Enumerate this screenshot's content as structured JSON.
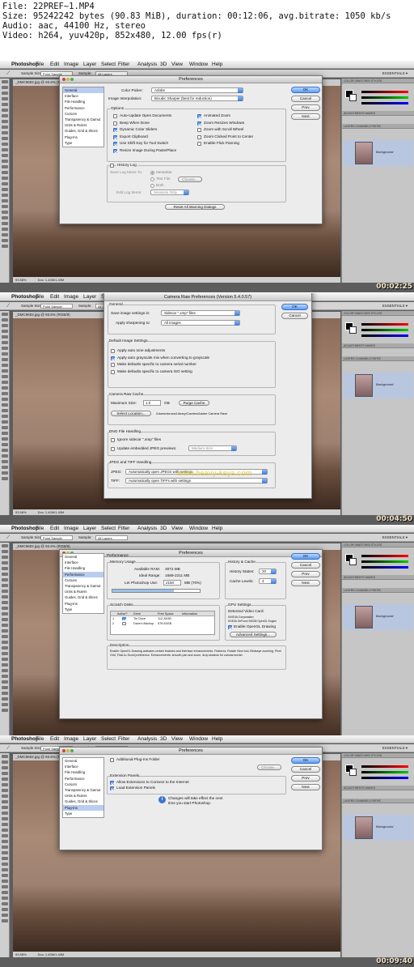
{
  "header": {
    "line1": "File: 22PREF~1.MP4",
    "line2": "Size: 95242242 bytes (90.83 MiB), duration: 00:12:06, avg.bitrate: 1050 kb/s",
    "line3": "Audio: aac, 44100 Hz, stereo",
    "line4": "Video: h264, yuv420p, 852x480, 12.00 fps(r)"
  },
  "app": {
    "menu": [
      "Photoshop",
      "File",
      "Edit",
      "Image",
      "Layer",
      "Select",
      "Filter",
      "Analysis",
      "3D",
      "View",
      "Window",
      "Help"
    ],
    "options": {
      "sample_size_label": "Sample Size:",
      "sample_size_value": "Point Sample",
      "sample_label": "Sample:",
      "sample_value": "All Layers",
      "workspace": "ESSENTIALS ▾"
    },
    "doc_tab": "_DMC9602.jpg @ 93.6% (RGB/8)",
    "status": "93.58%",
    "status_doc": "Doc: 1.40M/1.40M",
    "panel_tabs1": "COLOR  SWATCHES  STYLES",
    "panel_tabs2": "ADJUSTMENTS  MASKS",
    "panel_tabs3": "LAYERS  CHANNELS  PATHS",
    "layer_name": "Background"
  },
  "frames": [
    {
      "timestamp": "00:02:25",
      "dialog": {
        "title": "Preferences",
        "categories": [
          "General",
          "Interface",
          "File Handling",
          "Performance",
          "Cursors",
          "Transparency & Gamut",
          "Units & Rulers",
          "Guides, Grid & Slices",
          "Plug-Ins",
          "Type"
        ],
        "buttons": [
          "OK",
          "Cancel",
          "Prev",
          "Next"
        ],
        "color_picker_label": "Color Picker:",
        "color_picker_value": "Adobe",
        "interp_label": "Image Interpolation:",
        "interp_value": "Bicubic Sharper (best for reduction)",
        "options_title": "Options",
        "opts_left": [
          {
            "label": "Auto-Update Open Documents",
            "on": false
          },
          {
            "label": "Beep When Done",
            "on": false
          },
          {
            "label": "Dynamic Color Sliders",
            "on": true
          },
          {
            "label": "Export Clipboard",
            "on": true
          },
          {
            "label": "Use Shift Key for Tool Switch",
            "on": true
          },
          {
            "label": "Resize Image During Paste/Place",
            "on": true
          }
        ],
        "opts_right": [
          {
            "label": "Animated Zoom",
            "on": true
          },
          {
            "label": "Zoom Resizes Windows",
            "on": true
          },
          {
            "label": "Zoom with Scroll Wheel",
            "on": false
          },
          {
            "label": "Zoom Clicked Point to Center",
            "on": false
          },
          {
            "label": "Enable Flick Panning",
            "on": false
          }
        ],
        "history_log": "History Log",
        "save_items_to": "Save Log Items To:",
        "metadata": "Metadata",
        "text_file": "Text File",
        "choose": "Choose...",
        "both": "Both",
        "edit_log_items": "Edit Log Items:",
        "edit_log_value": "Sessions Only",
        "reset_warnings": "Reset All Warning Dialogs"
      }
    },
    {
      "timestamp": "00:04:50",
      "dialog": {
        "title": "Camera Raw Preferences  (Version 5.4.0.57)",
        "buttons": [
          "OK",
          "Cancel"
        ],
        "general_title": "General",
        "save_settings_label": "Save image settings in:",
        "save_settings_value": "Sidecar \".xmp\" files",
        "sharpen_label": "Apply sharpening to:",
        "sharpen_value": "All images",
        "defaults_title": "Default Image Settings",
        "defaults": [
          {
            "label": "Apply auto tone adjustments",
            "on": false
          },
          {
            "label": "Apply auto grayscale mix when converting to grayscale",
            "on": true
          },
          {
            "label": "Make defaults specific to camera serial number",
            "on": false
          },
          {
            "label": "Make defaults specific to camera ISO setting",
            "on": false
          }
        ],
        "cache_title": "Camera Raw Cache",
        "max_size_label": "Maximum Size:",
        "max_size_value": "1.0",
        "gb": "GB",
        "purge": "Purge Cache",
        "select_location": "Select Location...",
        "cache_path": "/Users/dcross/Library/Caches/Adobe Camera Raw/",
        "dng_title": "DNG File Handling",
        "ignore_sidecar": "Ignore sidecar \".xmp\" files",
        "update_jpeg": "Update embedded JPEG previews:",
        "medium_size": "Medium Size",
        "jpeg_tiff_title": "JPEG and TIFF Handling",
        "jpeg_label": "JPEG:",
        "jpeg_value": "Automatically open JPEGs with settings",
        "tiff_label": "TIFF:",
        "tiff_value": "Automatically open TIFFs with settings",
        "watermark": "www.heavy-keys.com"
      }
    },
    {
      "timestamp": "00:07:15",
      "dialog": {
        "title": "Preferences",
        "categories": [
          "General",
          "Interface",
          "File Handling",
          "Performance",
          "Cursors",
          "Transparency & Gamut",
          "Units & Rulers",
          "Guides, Grid & Slices",
          "Plug-Ins",
          "Type"
        ],
        "buttons": [
          "OK",
          "Cancel",
          "Prev",
          "Next"
        ],
        "perf_title": "Performance",
        "memory_title": "Memory Usage",
        "avail_ram_label": "Available RAM:",
        "avail_ram_value": "3072 MB",
        "ideal_label": "Ideal Range:",
        "ideal_value": "1689-2211 MB",
        "letps_label": "Let Photoshop Use:",
        "letps_value": "2150",
        "letps_unit": "MB (70%)",
        "letps_pct": 0.7,
        "hist_title": "History & Cache",
        "hist_states_label": "History States:",
        "hist_states_value": "20",
        "cache_levels_label": "Cache Levels:",
        "cache_levels_value": "4",
        "scratch_title": "Scratch Disks",
        "scratch_cols": [
          "Active?",
          "Drive",
          "Free Space",
          "Information"
        ],
        "scratch_rows": [
          {
            "n": "1",
            "active": true,
            "drive": "Tin Drive",
            "free": "112.25GB",
            "info": ""
          },
          {
            "n": "2",
            "active": false,
            "drive": "Dave's Backup",
            "free": "576.53GB",
            "info": ""
          }
        ],
        "gpu_title": "GPU Settings",
        "video_card_label": "Detected Video Card:",
        "card1": "NVIDIA Corporation",
        "card2": "NVIDIA GeForce 9400M OpenGL Engine",
        "enable_opengl": "Enable OpenGL Drawing",
        "advanced": "Advanced Settings...",
        "desc_title": "Description",
        "desc_text": "Enable OpenGL Drawing activates certain features and interface enhancements. Features: Rotate View tool, Birdseye zooming, Pixel Grid, Flick-to-Scroll preference. Enhancements: smooth pan and zoom, drop shadow for canvas border."
      }
    },
    {
      "timestamp": "00:09:40",
      "dialog": {
        "title": "Preferences",
        "categories": [
          "General",
          "Interface",
          "File Handling",
          "Performance",
          "Cursors",
          "Transparency & Gamut",
          "Units & Rulers",
          "Guides, Grid & Slices",
          "Plug-Ins",
          "Type"
        ],
        "buttons": [
          "OK",
          "Cancel",
          "Prev",
          "Next"
        ],
        "additional": "Additional Plug-Ins Folder",
        "choose": "Choose...",
        "ext_title": "Extension Panels",
        "allow_ext": "Allow Extensions to Connect to the Internet",
        "load_ext": "Load Extension Panels",
        "notice1": "Changes will take effect the next",
        "notice2": "time you start Photoshop."
      }
    }
  ]
}
